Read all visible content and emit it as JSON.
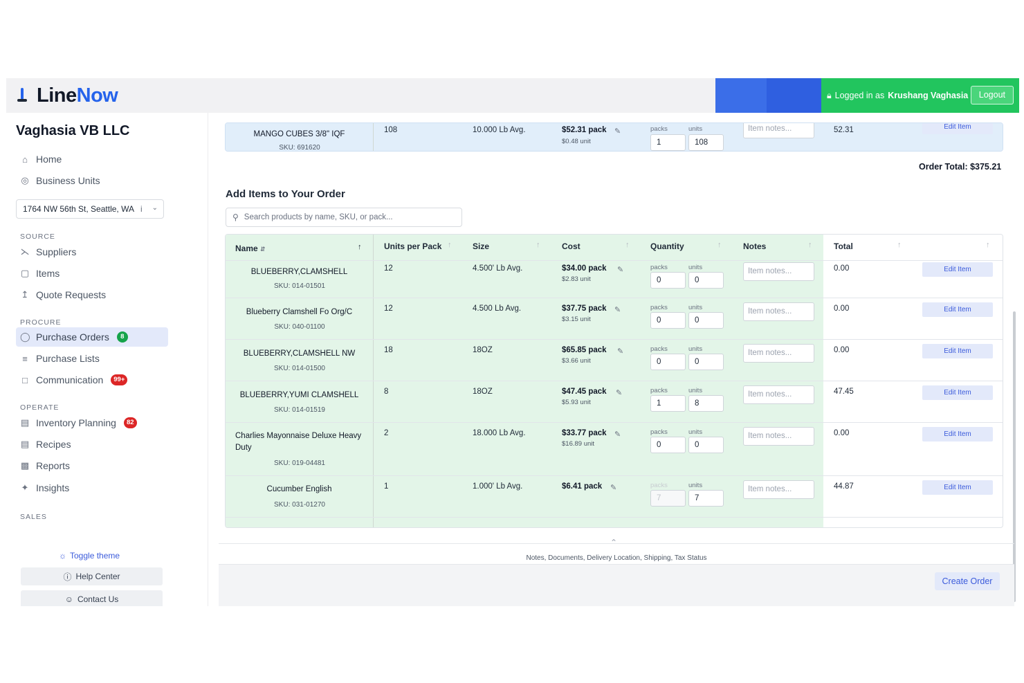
{
  "header": {
    "brand_part1": "Line",
    "brand_part2": "Now",
    "logged_in_prefix": "Logged in as",
    "user_name": "Krushang Vaghasia",
    "logout_label": "Logout",
    "colors": {
      "brand_blue": "#2563eb",
      "session_green": "#22c55e"
    }
  },
  "sidebar": {
    "org_name": "Vaghasia VB LLC",
    "top_items": [
      {
        "label": "Home",
        "icon": "home-icon"
      },
      {
        "label": "Business Units",
        "icon": "globe-icon"
      }
    ],
    "location": "1764 NW 56th St, Seattle, WA",
    "location_suffix": "i",
    "sections": [
      {
        "label": "SOURCE"
      },
      {
        "label": "PROCURE"
      },
      {
        "label": "OPERATE"
      },
      {
        "label": "SALES"
      }
    ],
    "source_items": [
      {
        "label": "Suppliers",
        "icon": "suppliers-icon"
      },
      {
        "label": "Items",
        "icon": "box-icon"
      },
      {
        "label": "Quote Requests",
        "icon": "upload-icon"
      }
    ],
    "procure_items": [
      {
        "label": "Purchase Orders",
        "icon": "basket-icon",
        "badge": "8"
      },
      {
        "label": "Purchase Lists",
        "icon": "list-icon"
      },
      {
        "label": "Communication",
        "icon": "chat-icon",
        "badge": "99+"
      }
    ],
    "operate_items": [
      {
        "label": "Inventory Planning",
        "icon": "calendar-icon",
        "badge": "82"
      },
      {
        "label": "Recipes",
        "icon": "document-icon"
      },
      {
        "label": "Reports",
        "icon": "bar-chart-icon"
      },
      {
        "label": "Insights",
        "icon": "sparkle-icon"
      }
    ],
    "toggle_theme": "Toggle theme",
    "help_center": "Help Center",
    "contact_us": "Contact Us"
  },
  "order": {
    "existing_item": {
      "name": "MANGO CUBES 3/8\" IQF",
      "sku": "SKU: 691620",
      "units_per_pack": "108",
      "size": "10.000 Lb Avg.",
      "cost_pack": "$52.31 pack",
      "cost_unit": "$0.48 unit",
      "packs": "1",
      "units": "108",
      "total": "52.31"
    },
    "order_total": "Order Total: $375.21"
  },
  "add_items": {
    "title": "Add Items to Your Order",
    "search_placeholder": "Search products by name, SKU, or pack...",
    "columns": {
      "name": "Name",
      "units_per_pack": "Units per Pack",
      "size": "Size",
      "cost": "Cost",
      "quantity": "Quantity",
      "notes": "Notes",
      "total": "Total"
    },
    "labels": {
      "packs": "packs",
      "units": "units",
      "notes_placeholder": "Item notes...",
      "edit": "Edit Item"
    },
    "rows": [
      {
        "name": "BLUEBERRY,CLAMSHELL",
        "sku": "SKU: 014-01501",
        "units_per_pack": "12",
        "size": "4.500' Lb Avg.",
        "cost_pack": "$34.00 pack",
        "cost_unit": "$2.83 unit",
        "packs": "0",
        "units": "0",
        "total": "0.00"
      },
      {
        "name": "Blueberry Clamshell Fo Org/C",
        "sku": "SKU: 040-01100",
        "units_per_pack": "12",
        "size": "4.500 Lb Avg.",
        "cost_pack": "$37.75 pack",
        "cost_unit": "$3.15 unit",
        "packs": "0",
        "units": "0",
        "total": "0.00"
      },
      {
        "name": "BLUEBERRY,CLAMSHELL NW",
        "sku": "SKU: 014-01500",
        "units_per_pack": "18",
        "size": "18OZ",
        "cost_pack": "$65.85 pack",
        "cost_unit": "$3.66 unit",
        "packs": "0",
        "units": "0",
        "total": "0.00"
      },
      {
        "name": "BLUEBERRY,YUMI CLAMSHELL",
        "sku": "SKU: 014-01519",
        "units_per_pack": "8",
        "size": "18OZ",
        "cost_pack": "$47.45 pack",
        "cost_unit": "$5.93 unit",
        "packs": "1",
        "units": "8",
        "total": "47.45"
      },
      {
        "name": "Charlies Mayonnaise Deluxe Heavy Duty",
        "sku": "SKU: 019-04481",
        "units_per_pack": "2",
        "size": "18.000 Lb Avg.",
        "cost_pack": "$33.77 pack",
        "cost_unit": "$16.89 unit",
        "packs": "0",
        "units": "0",
        "total": "0.00"
      },
      {
        "name": "Cucumber English",
        "sku": "SKU: 031-01270",
        "units_per_pack": "1",
        "size": "1.000' Lb Avg.",
        "cost_pack": "$6.41 pack",
        "cost_unit": "",
        "packs": "7",
        "units": "7",
        "total": "44.87"
      }
    ]
  },
  "footer": {
    "details_link": "Notes, Documents, Delivery Location, Shipping, Tax Status",
    "create_order": "Create Order"
  }
}
